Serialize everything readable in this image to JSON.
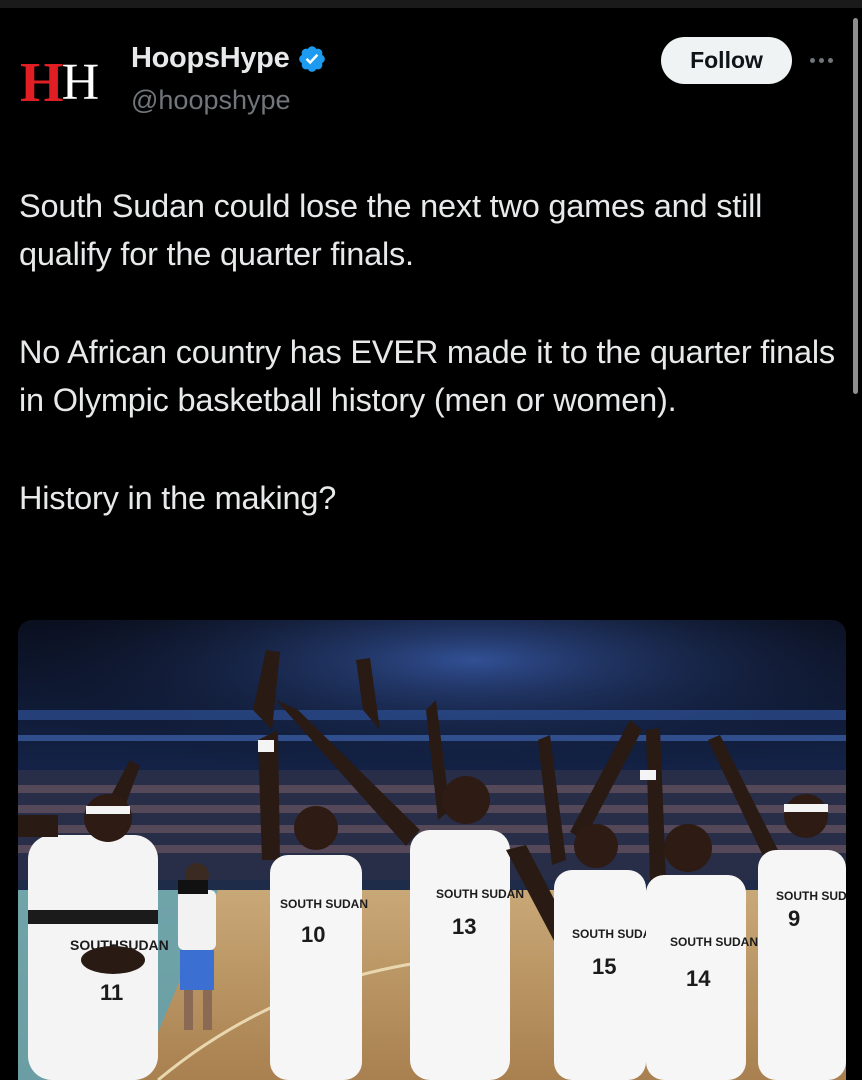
{
  "tweet": {
    "display_name": "HoopsHype",
    "handle": "@hoopshype",
    "verified": true,
    "avatar_logo": "HH",
    "follow_label": "Follow",
    "text_paragraphs": [
      "South Sudan could lose the next two games and still qualify for the quarter finals.",
      "No African country has EVER made it to the quarter finals in Olympic basketball history (men or women).",
      "History in the making?"
    ]
  },
  "media": {
    "jersey_texts": [
      "SOUTHSUDAN",
      "SOUTH SUDAN",
      "SOUTH SUDAN",
      "SOUTH SUDAN",
      "SOUTH SUDAN",
      "SOUTH SUDAN"
    ],
    "jersey_numbers": [
      "11",
      "10",
      "13",
      "15",
      "14",
      "9"
    ]
  },
  "colors": {
    "background": "#000000",
    "text": "#e7e9ea",
    "muted": "#71767b",
    "verified": "#1d9bf0",
    "logo_red": "#e01e24",
    "follow_bg": "#eff3f4"
  }
}
